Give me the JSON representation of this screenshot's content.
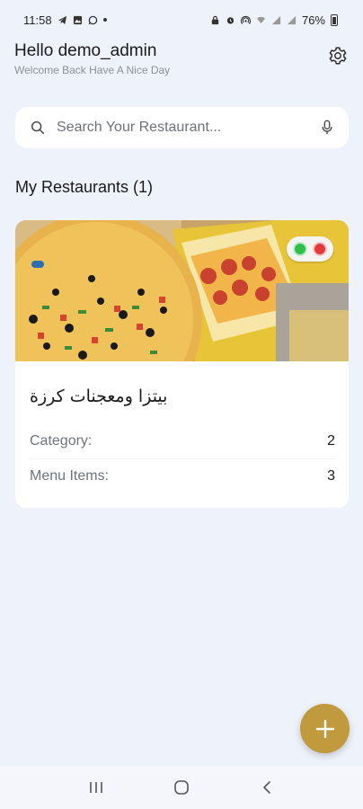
{
  "status_bar": {
    "time": "11:58",
    "battery": "76%"
  },
  "header": {
    "greeting": "Hello demo_admin",
    "subtitle": "Welcome Back Have A Nice Day"
  },
  "search": {
    "placeholder": "Search Your Restaurant..."
  },
  "section": {
    "title": "My Restaurants (1)"
  },
  "restaurants": [
    {
      "name": "بيتزا ومعجنات كرزة",
      "category_label": "Category:",
      "category_value": "2",
      "menu_items_label": "Menu Items:",
      "menu_items_value": "3"
    }
  ],
  "colors": {
    "accent": "#c09a3c",
    "background": "#eef2fb",
    "toggle_green": "#2fbf4c",
    "toggle_red": "#e33a3a"
  },
  "icons": {
    "settings": "gear-icon",
    "search": "search-icon",
    "mic": "mic-icon",
    "fab": "plus-icon",
    "nav_recents": "recents-icon",
    "nav_home": "home-icon",
    "nav_back": "back-icon"
  }
}
